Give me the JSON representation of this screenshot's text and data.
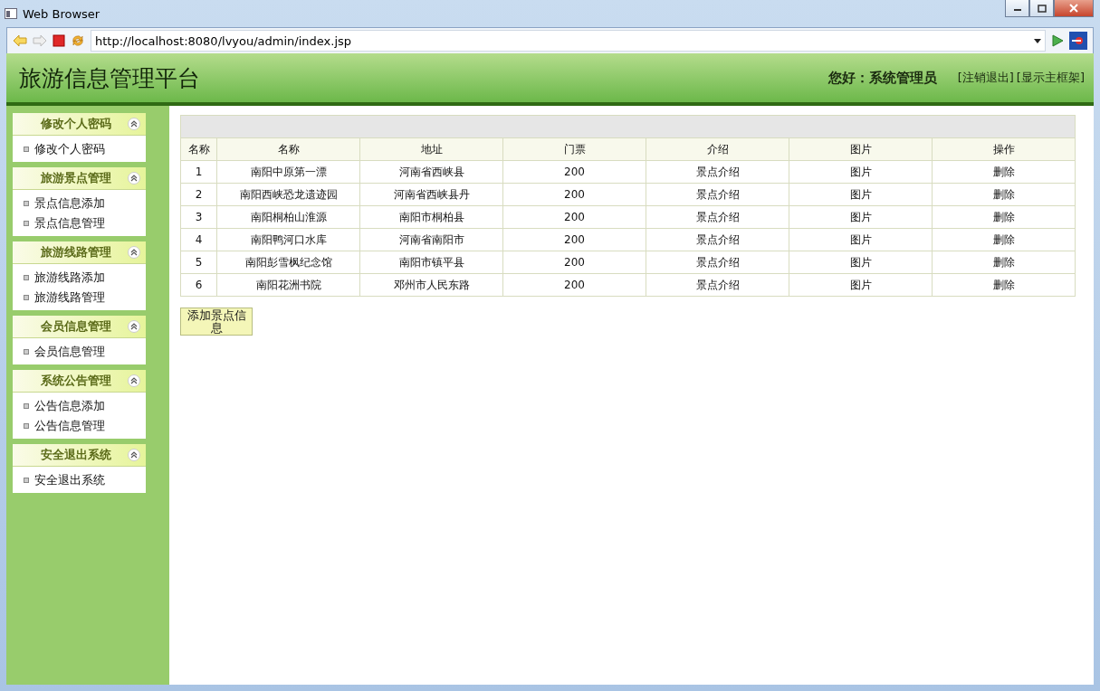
{
  "window": {
    "title": "Web Browser"
  },
  "toolbar": {
    "url": "http://localhost:8080/lvyou/admin/index.jsp"
  },
  "header": {
    "title": "旅游信息管理平台",
    "greeting": "您好：系统管理员",
    "links": [
      "[注销退出]",
      "[显示主框架]"
    ]
  },
  "sidebar": {
    "sections": [
      {
        "title": "修改个人密码",
        "expanded": true,
        "items": [
          "修改个人密码"
        ]
      },
      {
        "title": "旅游景点管理",
        "expanded": true,
        "items": [
          "景点信息添加",
          "景点信息管理"
        ]
      },
      {
        "title": "旅游线路管理",
        "expanded": true,
        "items": [
          "旅游线路添加",
          "旅游线路管理"
        ]
      },
      {
        "title": "会员信息管理",
        "expanded": true,
        "items": [
          "会员信息管理"
        ]
      },
      {
        "title": "系统公告管理",
        "expanded": true,
        "items": [
          "公告信息添加",
          "公告信息管理"
        ]
      },
      {
        "title": "安全退出系统",
        "expanded": true,
        "items": [
          "安全退出系统"
        ]
      }
    ]
  },
  "table": {
    "columns": [
      "名称",
      "名称",
      "地址",
      "门票",
      "介绍",
      "图片",
      "操作"
    ],
    "rows": [
      [
        "1",
        "南阳中原第一漂",
        "河南省西峡县",
        "200",
        "景点介绍",
        "图片",
        "删除"
      ],
      [
        "2",
        "南阳西峡恐龙遗迹园",
        "河南省西峡县丹",
        "200",
        "景点介绍",
        "图片",
        "删除"
      ],
      [
        "3",
        "南阳桐柏山淮源",
        "南阳市桐柏县",
        "200",
        "景点介绍",
        "图片",
        "删除"
      ],
      [
        "4",
        "南阳鸭河口水库",
        "河南省南阳市",
        "200",
        "景点介绍",
        "图片",
        "删除"
      ],
      [
        "5",
        "南阳彭雪枫纪念馆",
        "南阳市镇平县",
        "200",
        "景点介绍",
        "图片",
        "删除"
      ],
      [
        "6",
        "南阳花洲书院",
        "邓州市人民东路",
        "200",
        "景点介绍",
        "图片",
        "删除"
      ]
    ]
  },
  "add_button": {
    "label": "添加景点信息"
  }
}
